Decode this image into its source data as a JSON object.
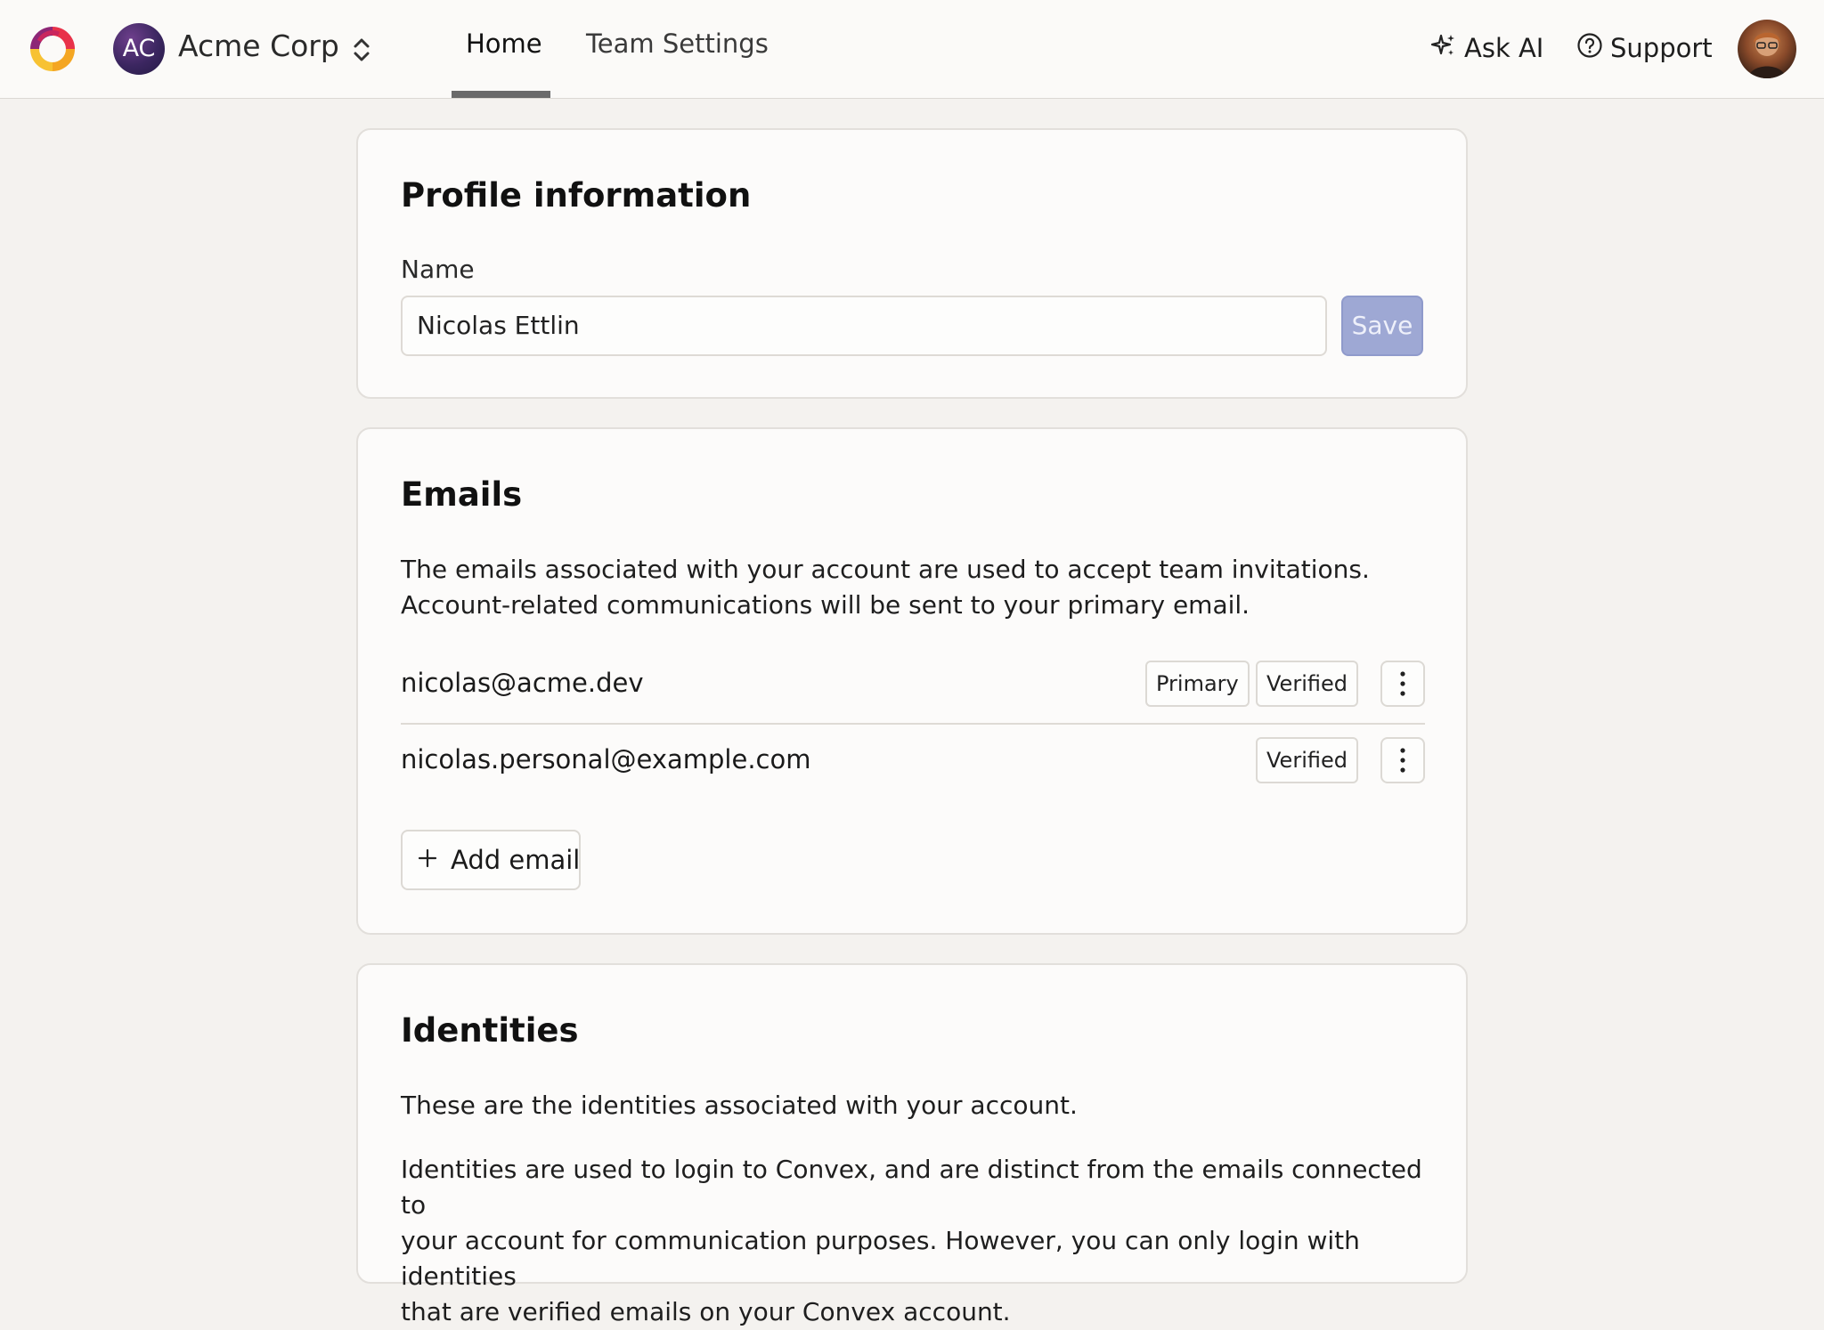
{
  "nav": {
    "team_initials": "AC",
    "team_name": "Acme Corp",
    "tabs": [
      {
        "label": "Home",
        "active": true
      },
      {
        "label": "Team Settings",
        "active": false
      }
    ],
    "ask_ai_label": "Ask AI",
    "support_label": "Support"
  },
  "profile": {
    "title": "Profile information",
    "name_label": "Name",
    "name_value": "Nicolas Ettlin",
    "save_label": "Save"
  },
  "emails": {
    "title": "Emails",
    "description_line1": "The emails associated with your account are used to accept team invitations.",
    "description_line2": "Account-related communications will be sent to your primary email.",
    "items": [
      {
        "address": "nicolas@acme.dev",
        "primary_badge": "Primary",
        "verified_badge": "Verified"
      },
      {
        "address": "nicolas.personal@example.com",
        "verified_badge": "Verified"
      }
    ],
    "add_label": "Add email"
  },
  "identities": {
    "title": "Identities",
    "description1": "These are the identities associated with your account.",
    "description2_line1": "Identities are used to login to Convex, and are distinct from the emails connected to",
    "description2_line2": "your account for communication purposes. However, you can only login with identities",
    "description2_line3": "that are verified emails on your Convex account."
  },
  "colors": {
    "accent_save": "#9ea8d4",
    "page_bg": "#f4f2ef",
    "card_bg": "#fcfbfa"
  },
  "icons": {
    "logo": "convex-logo",
    "team_switcher": "chevron-up-down-icon",
    "ask_ai": "sparkles-icon",
    "support": "question-circle-icon",
    "email_menu": "kebab-menu-icon",
    "add_email": "plus-icon"
  }
}
